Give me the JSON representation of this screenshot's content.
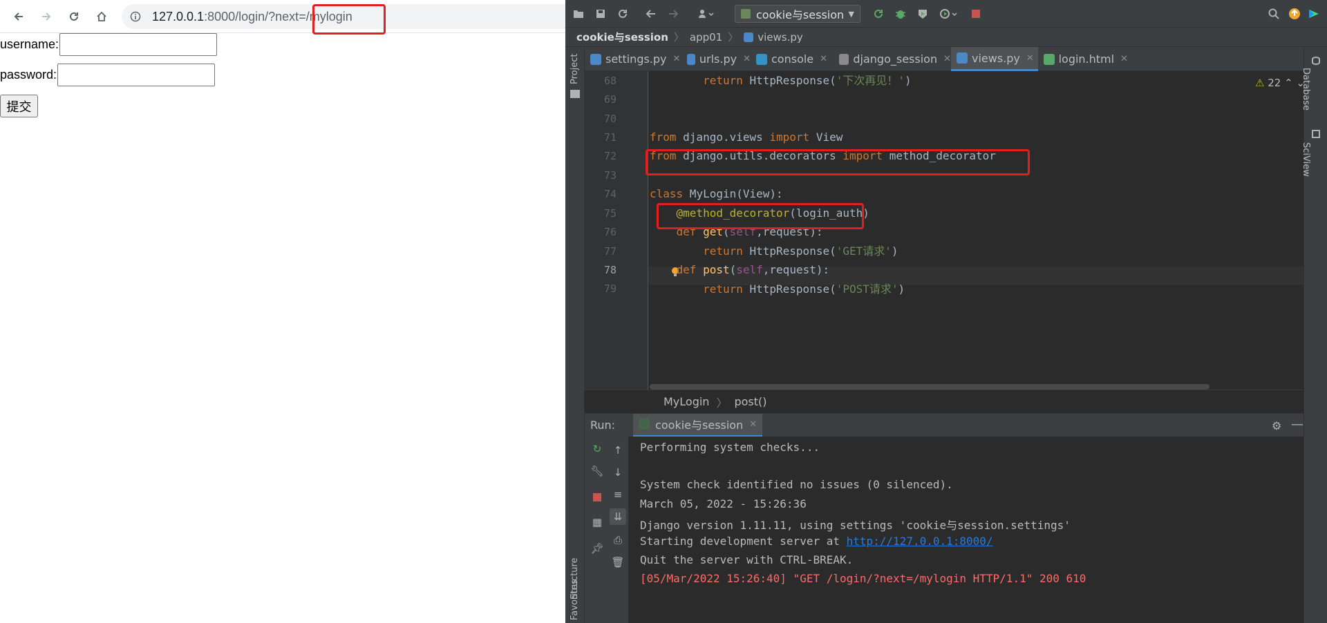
{
  "browser": {
    "url_host": "127.0.0.1",
    "url_rest": ":8000/login/?next=/mylogin",
    "form": {
      "username_label": "username:",
      "password_label": "password:",
      "submit_label": "提交"
    }
  },
  "ide": {
    "run_config": "cookie与session",
    "breadcrumbs": [
      "cookie与session",
      "app01",
      "views.py"
    ],
    "left_panels": [
      "Project",
      "Structure",
      "Favorites"
    ],
    "right_panels": [
      "Database",
      "SciView"
    ],
    "tabs": [
      {
        "label": "settings.py",
        "active": false
      },
      {
        "label": "urls.py",
        "active": false
      },
      {
        "label": "console",
        "active": false
      },
      {
        "label": "django_session",
        "active": false
      },
      {
        "label": "views.py",
        "active": true
      },
      {
        "label": "login.html",
        "active": false
      }
    ],
    "warnings_count": "22",
    "line_numbers": [
      "68",
      "69",
      "70",
      "71",
      "72",
      "73",
      "74",
      "75",
      "76",
      "77",
      "78",
      "79"
    ],
    "current_line": "78",
    "code": {
      "l68_kw": "return",
      "l68_rest": " HttpResponse(",
      "l68_str": "'下次再见！'",
      "l68_end": ")",
      "l71_from": "from",
      "l71_mod": " django.views ",
      "l71_import": "import",
      "l71_name": " View",
      "l72_from": "from",
      "l72_mod": " django.utils.decorators ",
      "l72_import": "import",
      "l72_name": " method_decorator",
      "l74_class": "class",
      "l74_name": " MyLogin(View):",
      "l75_deco": "@method_decorator",
      "l75_arg": "(login_auth)",
      "l76_def": "def",
      "l76_fn": " get",
      "l76_open": "(",
      "l76_self": "self",
      "l76_rest": ",request):",
      "l77_kw": "return",
      "l77_rest": " HttpResponse(",
      "l77_str": "'GET请求'",
      "l77_end": ")",
      "l78_def": "def",
      "l78_fn": " post",
      "l78_open": "(",
      "l78_self": "self",
      "l78_rest": ",request):",
      "l79_kw": "return",
      "l79_rest": " HttpResponse(",
      "l79_str": "'POST请求'",
      "l79_end": ")"
    },
    "editor_breadcrumb": [
      "MyLogin",
      "post()"
    ],
    "run": {
      "label": "Run:",
      "tab": "cookie与session",
      "console": [
        "Performing system checks...",
        "",
        "System check identified no issues (0 silenced).",
        "March 05, 2022 - 15:26:36",
        "Django version 1.11.11, using settings 'cookie与session.settings'",
        "Starting development server at ",
        "Quit the server with CTRL-BREAK.",
        "[05/Mar/2022 15:26:40] \"GET /login/?next=/mylogin HTTP/1.1\" 200 610"
      ],
      "server_link": "http://127.0.0.1:8000/"
    }
  },
  "colors": {
    "highlight_box": "#e02020",
    "ide_bg": "#2b2b2b",
    "keyword": "#cc7832",
    "string": "#6a8759",
    "decorator": "#bbb529",
    "link": "#287bde",
    "error_text": "#ff6b68"
  },
  "icons": [
    "back-arrow-icon",
    "forward-arrow-icon",
    "reload-icon",
    "home-icon",
    "info-icon",
    "folder-icon",
    "save-icon",
    "sync-icon",
    "run-icon",
    "debug-icon",
    "stop-icon",
    "search-icon",
    "settings-gear-icon",
    "close-icon"
  ]
}
